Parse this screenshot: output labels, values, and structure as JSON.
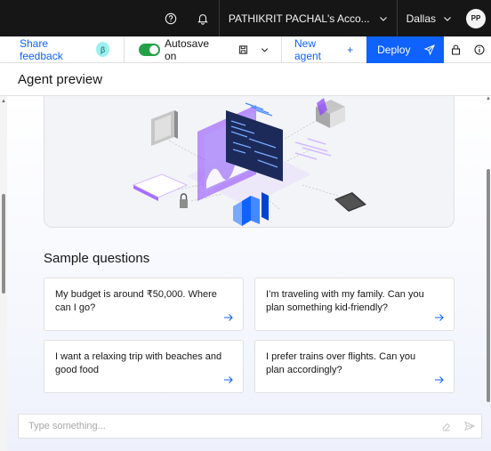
{
  "topbar": {
    "account_name": "PATHIKRIT PACHAL's Acco...",
    "region": "Dallas",
    "avatar_initials": "PP"
  },
  "toolbar": {
    "share_feedback": "Share feedback",
    "beta_badge": "β",
    "autosave_label": "Autosave on",
    "autosave_on": true,
    "new_agent_label": "New agent",
    "new_agent_plus": "+",
    "deploy_label": "Deploy"
  },
  "page": {
    "title": "Agent preview"
  },
  "sample": {
    "title": "Sample questions",
    "questions": [
      "My budget is around ₹50,000. Where can I go?",
      "I’m traveling with my family. Can you plan something kid-friendly?",
      "I want a relaxing trip with beaches and good food",
      "I prefer trains over flights. Can you plan accordingly?"
    ]
  },
  "chat_input": {
    "placeholder": "Type something..."
  },
  "colors": {
    "accent": "#0f62fe",
    "topbar_bg": "#161616",
    "toggle_on": "#24a148",
    "hero_purple": "#8a3ffc"
  }
}
